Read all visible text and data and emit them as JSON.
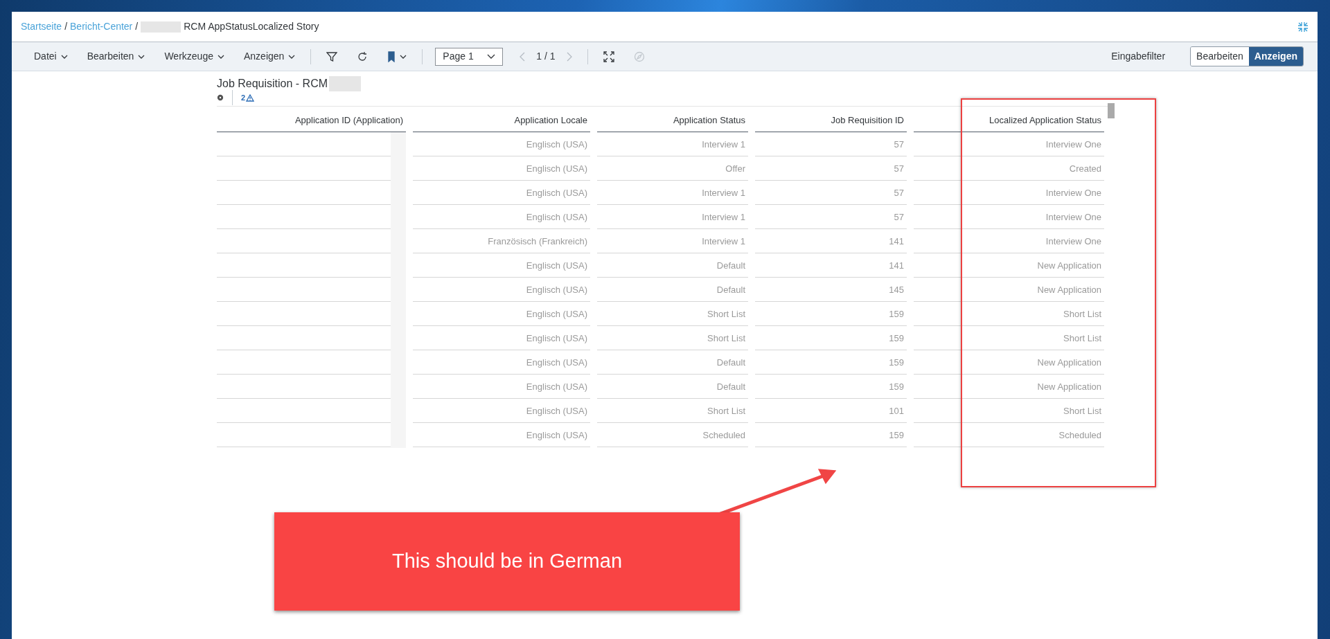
{
  "breadcrumb": [
    {
      "label": "Startseite",
      "kind": "link"
    },
    {
      "label": "/",
      "kind": "separator"
    },
    {
      "label": "Bericht-Center",
      "kind": "link"
    },
    {
      "label": "/",
      "kind": "separator"
    },
    {
      "label": "RCM AppStatusLocalized Story",
      "kind": "current"
    }
  ],
  "menus": [
    "Datei",
    "Bearbeiten",
    "Werkzeuge",
    "Anzeigen"
  ],
  "page_select": {
    "value": "Page 1"
  },
  "page_counter": "1 / 1",
  "input_filter": "Eingabefilter",
  "mode_toggle": [
    {
      "label": "Bearbeiten",
      "selected": false
    },
    {
      "label": "Anzeigen",
      "selected": true
    }
  ],
  "table_title": "Job Requisition - RCM",
  "warning_count": "2",
  "table": {
    "columns": [
      "Application ID (Application)",
      "Application Locale",
      "Application Status",
      "Job Requisition ID",
      "Localized Application Status"
    ],
    "rows": [
      [
        "",
        "Englisch (USA)",
        "Interview 1",
        "57",
        "Interview One"
      ],
      [
        "",
        "Englisch (USA)",
        "Offer",
        "57",
        "Created"
      ],
      [
        "",
        "Englisch (USA)",
        "Interview 1",
        "57",
        "Interview One"
      ],
      [
        "",
        "Englisch (USA)",
        "Interview 1",
        "57",
        "Interview One"
      ],
      [
        "",
        "Französisch (Frankreich)",
        "Interview 1",
        "141",
        "Interview One"
      ],
      [
        "",
        "Englisch (USA)",
        "Default",
        "141",
        "New Application"
      ],
      [
        "",
        "Englisch (USA)",
        "Default",
        "145",
        "New Application"
      ],
      [
        "",
        "Englisch (USA)",
        "Short List",
        "159",
        "Short List"
      ],
      [
        "",
        "Englisch (USA)",
        "Short List",
        "159",
        "Short List"
      ],
      [
        "",
        "Englisch (USA)",
        "Default",
        "159",
        "New Application"
      ],
      [
        "",
        "Englisch (USA)",
        "Default",
        "159",
        "New Application"
      ],
      [
        "",
        "Englisch (USA)",
        "Short List",
        "101",
        "Short List"
      ],
      [
        "",
        "Englisch (USA)",
        "Scheduled",
        "159",
        "Scheduled"
      ]
    ]
  },
  "callout": "This should be in German"
}
